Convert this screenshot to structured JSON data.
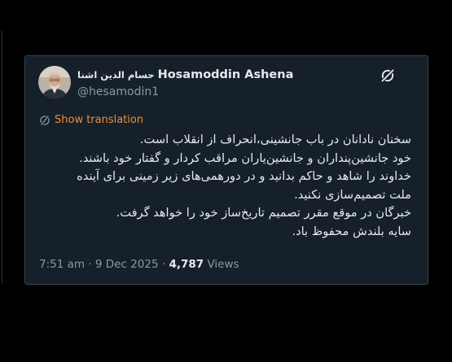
{
  "tweet": {
    "display_name": "Hosamoddin Ashena",
    "display_name_fa": "حسام الدین اشنا",
    "handle": "@hesamodin1",
    "show_translation": "Show translation",
    "lines": [
      "سخنان نادانان در باب جانشینی،انحراف از انقلاب است.",
      "خود جانشین‌پنداران و جانشین‌یاران مراقب کردار و گفتار خود باشند.",
      "خداوند را شاهد و حاکم بدانید و در دورهمی‌های زیر زمینی برای آینده",
      "ملت تصمیم‌سازی نکنید.",
      "خبرگان در موقع مقرر تصمیم تاریخ‌ساز خود را خواهد گرفت.",
      "سایه بلندش محفوظ باد."
    ],
    "time": "7:51 am",
    "date": "9 Dec 2025",
    "separator": "·",
    "views_count": "4,787",
    "views_label": "Views"
  },
  "colors": {
    "background": "#000000",
    "card": "#15202b",
    "border": "#38444d",
    "text": "#e7e9ea",
    "muted": "#8b98a5",
    "accent": "#f08c36"
  },
  "icons": {
    "logo": "grok-logo-icon",
    "translate": "translate-icon",
    "avatar": "avatar-photo"
  }
}
